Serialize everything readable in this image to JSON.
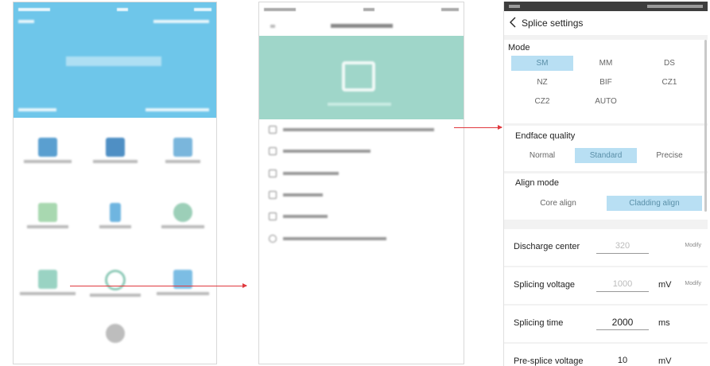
{
  "screen": {
    "back_icon": "chevron-left-icon",
    "title": "Splice settings",
    "mode": {
      "label": "Mode",
      "options": [
        "SM",
        "MM",
        "DS",
        "NZ",
        "BIF",
        "CZ1",
        "CZ2",
        "AUTO"
      ],
      "selected": "SM"
    },
    "endface": {
      "label": "Endface quality",
      "options": [
        "Normal",
        "Standard",
        "Precise"
      ],
      "selected": "Standard"
    },
    "align": {
      "label": "Align mode",
      "options": [
        "Core align",
        "Cladding align"
      ],
      "selected": "Cladding align"
    },
    "fields": {
      "discharge_center": {
        "label": "Discharge center",
        "value": "320",
        "action": "Modify"
      },
      "splicing_voltage": {
        "label": "Splicing voltage",
        "value": "1000",
        "unit": "mV",
        "action": "Modify"
      },
      "splicing_time": {
        "label": "Splicing time",
        "value": "2000",
        "unit": "ms"
      },
      "pre_splice_voltage": {
        "label": "Pre-splice voltage",
        "value": "10",
        "unit": "mV"
      }
    }
  },
  "colors": {
    "home_header": "#6ec6ea",
    "banner": "#9fd6c9",
    "selected_cell": "#b8dff3",
    "arrow": "#e0393e"
  }
}
